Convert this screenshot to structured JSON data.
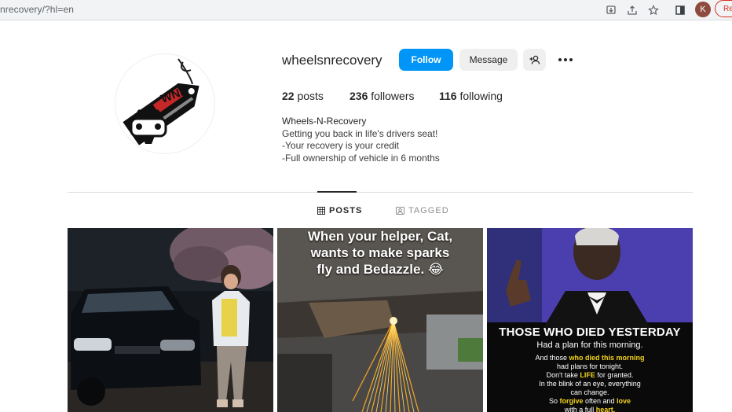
{
  "browser": {
    "url": "nrecovery/?hl=en",
    "profile_initial": "K",
    "relaunch_label": "Re"
  },
  "profile": {
    "username": "wheelsnrecovery",
    "follow_label": "Follow",
    "message_label": "Message",
    "posts_count": "22",
    "posts_label": "posts",
    "followers_count": "236",
    "followers_label": "followers",
    "following_count": "116",
    "following_label": "following",
    "bio_name": "Wheels-N-Recovery",
    "bio_lines": [
      "Getting you back in life's drivers seat!",
      "-Your recovery is your credit",
      "-Full ownership of vehicle in 6 months"
    ],
    "avatar_text": "WNR"
  },
  "tabs": {
    "posts": "POSTS",
    "tagged": "TAGGED"
  },
  "posts": {
    "post2_caption": [
      "When your helper, Cat,",
      "wants to make sparks",
      "fly and Bedazzle. 😂"
    ],
    "post3_headline": "THOSE WHO DIED YESTERDAY",
    "post3_sub": "Had a plan for this morning.",
    "post3_body": [
      [
        "And those ",
        "who died this morning",
        ""
      ],
      [
        "had plans for tonight.",
        "",
        ""
      ],
      [
        "Don't take ",
        "LIFE",
        " for granted."
      ],
      [
        "In the blink of an eye, everything",
        "",
        ""
      ],
      [
        "can change.",
        "",
        ""
      ],
      [
        "So ",
        "forgive",
        " often and ",
        "love"
      ],
      [
        "with a full ",
        "heart.",
        ""
      ]
    ]
  },
  "colors": {
    "follow_blue": "#0095f6",
    "button_gray": "#efefef",
    "quote_yellow": "#f2d31b"
  }
}
